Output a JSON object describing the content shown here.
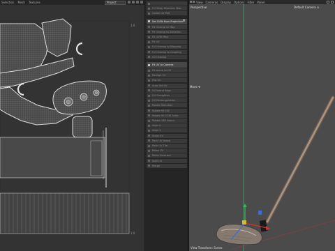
{
  "uv_editor": {
    "menu": [
      "Selection",
      "Mesh",
      "Textures"
    ],
    "select_value": "Project",
    "tick_top_right": "1.0",
    "tick_bottom_right": "1.0"
  },
  "side_panel": {
    "items": [
      {
        "label": "",
        "highlight": false
      },
      {
        "label": "UV Wrap Direction Map",
        "highlight": false
      },
      {
        "label": "Unlink UV Pelt",
        "highlight": false
      },
      {
        "label": "Set UVW from Projection",
        "highlight": true,
        "gear": "⚙"
      },
      {
        "label": "Fit Unwrap to Map",
        "highlight": false
      },
      {
        "label": "Fit Unwrap to Selection",
        "highlight": false
      },
      {
        "label": "Fit UVW Map",
        "highlight": false
      },
      {
        "label": "Fit UV",
        "highlight": false
      },
      {
        "label": "UV Unwrap to Mapping",
        "highlight": false
      },
      {
        "label": "UV Unwrap to Coupling",
        "highlight": false
      },
      {
        "label": "UV Unwrap",
        "highlight": false
      },
      {
        "label": "Fit UV to Camera",
        "highlight": true
      },
      {
        "label": "Fit Island to UV",
        "highlight": false
      },
      {
        "label": "Realign UV",
        "highlight": false
      },
      {
        "label": "Flip UV",
        "highlight": false
      },
      {
        "label": "Auto Set UV",
        "highlight": false
      },
      {
        "label": "UV Island Align",
        "highlight": false
      },
      {
        "label": "UV Straighten",
        "highlight": false
      },
      {
        "label": "UV Rectangulation",
        "highlight": false
      },
      {
        "label": "Rotate Selection",
        "highlight": false
      },
      {
        "label": "Rotate 90 CW",
        "highlight": false
      },
      {
        "label": "Rotate 90 CCW Selec",
        "highlight": false
      },
      {
        "label": "Rotate 180 Island",
        "highlight": false
      },
      {
        "label": "Align U",
        "highlight": false
      },
      {
        "label": "Align V",
        "highlight": false
      },
      {
        "label": "Scale UV",
        "highlight": false
      },
      {
        "label": "Pack UV Island",
        "highlight": false
      },
      {
        "label": "Pack UV Tile",
        "highlight": false
      },
      {
        "label": "Relax UV",
        "highlight": false
      },
      {
        "label": "Relax Selected",
        "highlight": false
      },
      {
        "label": "Split UV",
        "highlight": false
      },
      {
        "label": "Merge",
        "highlight": false
      }
    ]
  },
  "viewport": {
    "menu": [
      "View",
      "Cameras",
      "Display",
      "Options",
      "Filter",
      "Panel"
    ],
    "perspective_label": "Perspective",
    "camera_label": "Default Camera ⊙",
    "move_label": "Move ✣",
    "footer_label": "View Transform: Scene"
  }
}
